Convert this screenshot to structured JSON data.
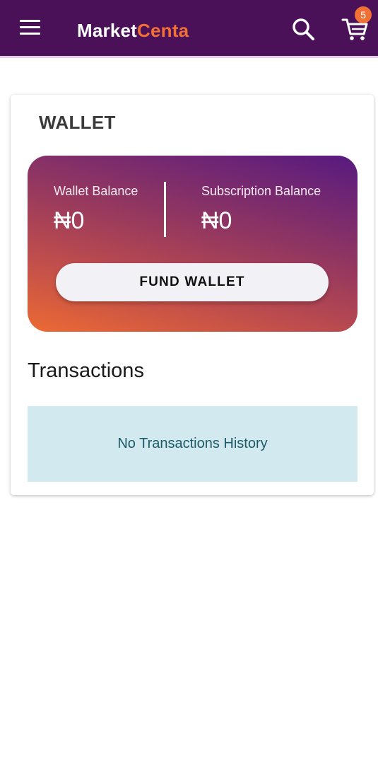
{
  "header": {
    "brand_part1": "Market",
    "brand_part2": "Centa",
    "menu_icon": "hamburger-menu-icon",
    "search_icon": "search-icon",
    "cart_icon": "shopping-cart-icon",
    "cart_count": "5",
    "bar_color": "#4a1158",
    "accent_color": "#f07036"
  },
  "wallet": {
    "title": "WALLET",
    "wallet_balance_label": "Wallet Balance",
    "wallet_balance_value": "₦0",
    "subscription_balance_label": "Subscription Balance",
    "subscription_balance_value": "₦0",
    "fund_button_label": "FUND WALLET"
  },
  "transactions": {
    "heading": "Transactions",
    "empty_message": "No Transactions History"
  }
}
